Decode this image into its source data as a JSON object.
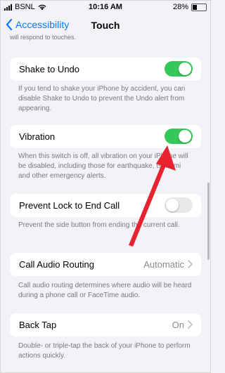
{
  "status_bar": {
    "carrier": "BSNL",
    "time": "10:16 AM",
    "battery": "28%",
    "battery_level": 0.28
  },
  "nav": {
    "back_label": "Accessibility",
    "title": "Touch"
  },
  "clipped_text": "will respond to touches.",
  "settings": [
    {
      "label": "Shake to Undo",
      "control": "toggle",
      "on": true,
      "description": "If you tend to shake your iPhone by accident, you can disable Shake to Undo to prevent the Undo alert from appearing."
    },
    {
      "label": "Vibration",
      "control": "toggle",
      "on": true,
      "description": "When this switch is off, all vibration on your iPhone will be disabled, including those for earthquake, tsunami and other emergency alerts."
    },
    {
      "label": "Prevent Lock to End Call",
      "control": "toggle",
      "on": false,
      "description": "Prevent the side button from ending the current call."
    },
    {
      "label": "Call Audio Routing",
      "control": "disclosure",
      "value": "Automatic",
      "description": "Call audio routing determines where audio will be heard during a phone call or FaceTime audio."
    },
    {
      "label": "Back Tap",
      "control": "disclosure",
      "value": "On",
      "description": "Double- or triple-tap the back of your iPhone to perform actions quickly."
    }
  ],
  "colors": {
    "accent": "#0a7bff",
    "toggle_on": "#34c759",
    "toggle_off": "#e9e9ea",
    "arrow": "#e8232f"
  }
}
